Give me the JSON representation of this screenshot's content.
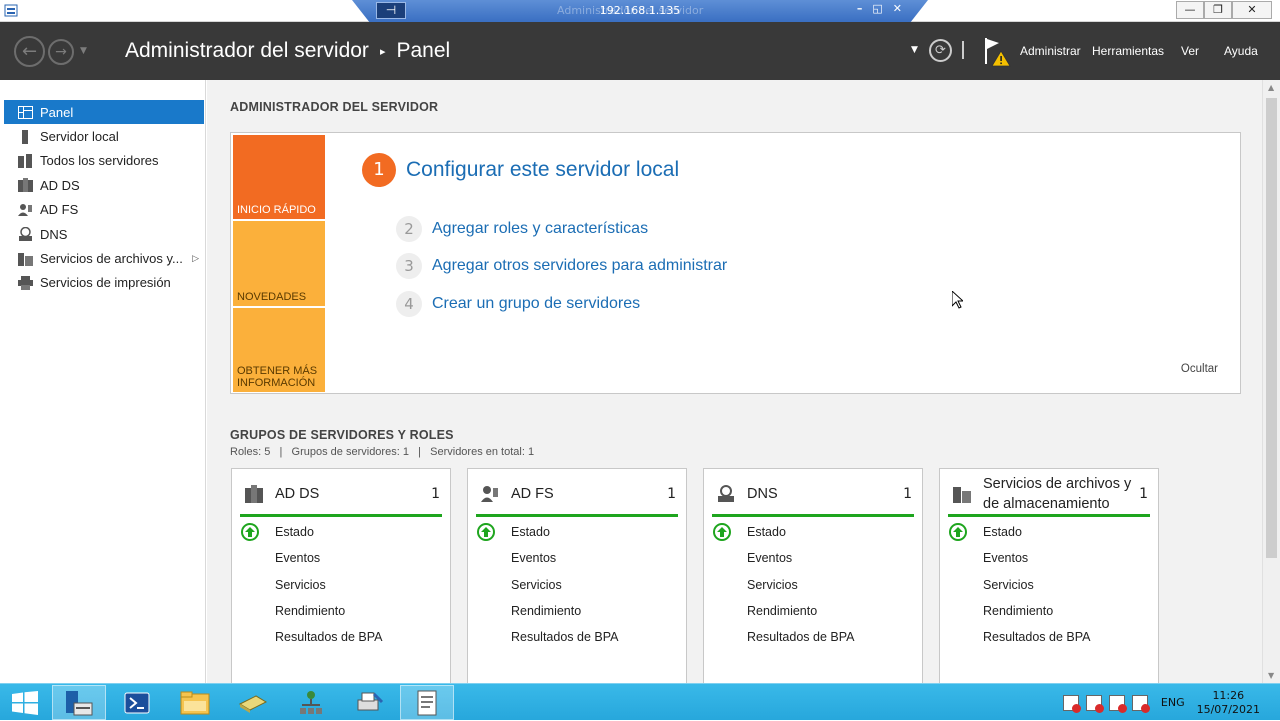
{
  "rdp": {
    "address": "192.168.1.135",
    "ghost_title": "Administrador del servidor"
  },
  "window": {
    "minimize": "—",
    "restore": "❐",
    "close": "✕"
  },
  "header": {
    "app_title": "Administrador del servidor",
    "breadcrumb_sep": "▸",
    "page": "Panel",
    "menus": [
      "Administrar",
      "Herramientas",
      "Ver",
      "Ayuda"
    ]
  },
  "sidebar": {
    "items": [
      {
        "label": "Panel",
        "icon": "dashboard-icon"
      },
      {
        "label": "Servidor local",
        "icon": "server-icon"
      },
      {
        "label": "Todos los servidores",
        "icon": "servers-icon"
      },
      {
        "label": "AD DS",
        "icon": "ad-ds-icon"
      },
      {
        "label": "AD FS",
        "icon": "ad-fs-icon"
      },
      {
        "label": "DNS",
        "icon": "dns-icon"
      },
      {
        "label": "Servicios de archivos y...",
        "icon": "file-services-icon"
      },
      {
        "label": "Servicios de impresión",
        "icon": "printer-icon"
      }
    ]
  },
  "welcome": {
    "title": "ADMINISTRADOR DEL SERVIDOR",
    "tiles": [
      "INICIO RÁPIDO",
      "NOVEDADES",
      "OBTENER MÁS INFORMACIÓN"
    ],
    "steps": [
      {
        "num": "1",
        "label": "Configurar este servidor local"
      },
      {
        "num": "2",
        "label": "Agregar roles y características"
      },
      {
        "num": "3",
        "label": "Agregar otros servidores para administrar"
      },
      {
        "num": "4",
        "label": "Crear un grupo de servidores"
      }
    ],
    "hide": "Ocultar"
  },
  "groups": {
    "title": "GRUPOS DE SERVIDORES Y ROLES",
    "summary": "Roles: 5   |   Grupos de servidores: 1   |   Servidores en total: 1",
    "cards": [
      {
        "title": "AD DS",
        "count": "1",
        "icon": "ad-ds-icon"
      },
      {
        "title": "AD FS",
        "count": "1",
        "icon": "ad-fs-icon"
      },
      {
        "title": "DNS",
        "count": "1",
        "icon": "dns-icon"
      },
      {
        "title": "Servicios de archivos y de almacenamiento",
        "count": "1",
        "icon": "file-services-icon"
      }
    ],
    "rows": [
      "Estado",
      "Eventos",
      "Servicios",
      "Rendimiento",
      "Resultados de BPA"
    ]
  },
  "taskbar": {
    "lang": "ENG",
    "time": "11:26",
    "date": "15/07/2021"
  },
  "colors": {
    "accent": "#1979ca",
    "header_bg": "#393939",
    "orange": "#f26b22",
    "amber": "#fbb03b",
    "ok_green": "#1ea51e",
    "taskbar": "#2fb0e2"
  }
}
